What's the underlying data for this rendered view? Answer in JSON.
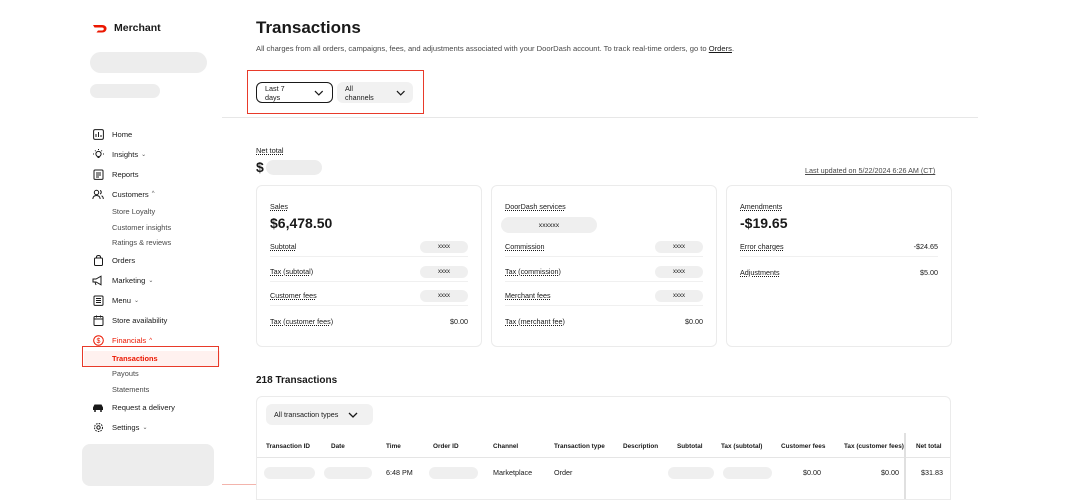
{
  "brand": {
    "name": "Merchant"
  },
  "sidebar": {
    "items": [
      {
        "label": "Home",
        "icon": "chart-icon"
      },
      {
        "label": "Insights",
        "icon": "lightbulb-icon",
        "chevron": "⌄"
      },
      {
        "label": "Reports",
        "icon": "report-icon"
      },
      {
        "label": "Customers",
        "icon": "people-icon",
        "chevron": "^"
      },
      {
        "label": "Store Loyalty",
        "sub": true
      },
      {
        "label": "Customer insights",
        "sub": true
      },
      {
        "label": "Ratings & reviews",
        "sub": true
      },
      {
        "label": "Orders",
        "icon": "bag-icon"
      },
      {
        "label": "Marketing",
        "icon": "megaphone-icon",
        "chevron": "⌄"
      },
      {
        "label": "Menu",
        "icon": "menu-icon",
        "chevron": "⌄"
      },
      {
        "label": "Store availability",
        "icon": "calendar-icon"
      },
      {
        "label": "Financials",
        "icon": "dollar-icon",
        "chevron": "^",
        "active": true
      },
      {
        "label": "Transactions",
        "sub": true,
        "active": true
      },
      {
        "label": "Payouts",
        "sub": true
      },
      {
        "label": "Statements",
        "sub": true
      },
      {
        "label": "Request a delivery",
        "icon": "car-icon"
      },
      {
        "label": "Settings",
        "icon": "gear-icon",
        "chevron": "⌄"
      }
    ]
  },
  "header": {
    "title": "Transactions",
    "description": "All charges from all orders, campaigns, fees, and adjustments associated with your DoorDash account. To track real-time orders, go to ",
    "description_link": "Orders",
    "description_end": "."
  },
  "filters": {
    "date": "Last 7 days",
    "channel": "All channels"
  },
  "net_total": {
    "label": "Net total",
    "currency": "$",
    "updated": "Last updated on 5/22/2024 6:26 AM (CT)"
  },
  "cards": {
    "sales": {
      "label": "Sales",
      "value": "$6,478.50",
      "rows": [
        {
          "label": "Subtotal",
          "value": "xxxx",
          "pill": true
        },
        {
          "label": "Tax (subtotal)",
          "value": "xxxx",
          "pill": true
        },
        {
          "label": "Customer fees",
          "value": "xxxx",
          "pill": true
        },
        {
          "label": "Tax (customer fees)",
          "value": "$0.00",
          "pill": false
        }
      ]
    },
    "services": {
      "label": "DoorDash services",
      "value": "xxxxxx",
      "rows": [
        {
          "label": "Commission",
          "value": "xxxx",
          "pill": true
        },
        {
          "label": "Tax (commission)",
          "value": "xxxx",
          "pill": true
        },
        {
          "label": "Merchant fees",
          "value": "xxxx",
          "pill": true
        },
        {
          "label": "Tax (merchant fee)",
          "value": "$0.00",
          "pill": false
        }
      ]
    },
    "amendments": {
      "label": "Amendments",
      "value": "-$19.65",
      "rows": [
        {
          "label": "Error charges",
          "value": "-$24.65",
          "pill": false
        },
        {
          "label": "Adjustments",
          "value": "$5.00",
          "pill": false
        }
      ]
    }
  },
  "transactions": {
    "count_label": "218 Transactions",
    "type_filter": "All transaction types",
    "columns": [
      "Transaction ID",
      "Date",
      "Time",
      "Order ID",
      "Channel",
      "Transaction type",
      "Description",
      "Subtotal",
      "Tax (subtotal)",
      "Customer fees",
      "Tax (customer fees)",
      "Net total"
    ],
    "row": {
      "time": "6:48 PM",
      "channel": "Marketplace",
      "type": "Order",
      "customer_fees": "$0.00",
      "tax_customer_fees": "$0.00",
      "net_total": "$31.83"
    }
  },
  "colors": {
    "accent": "#eb1700",
    "highlight": "#e83a2a"
  }
}
